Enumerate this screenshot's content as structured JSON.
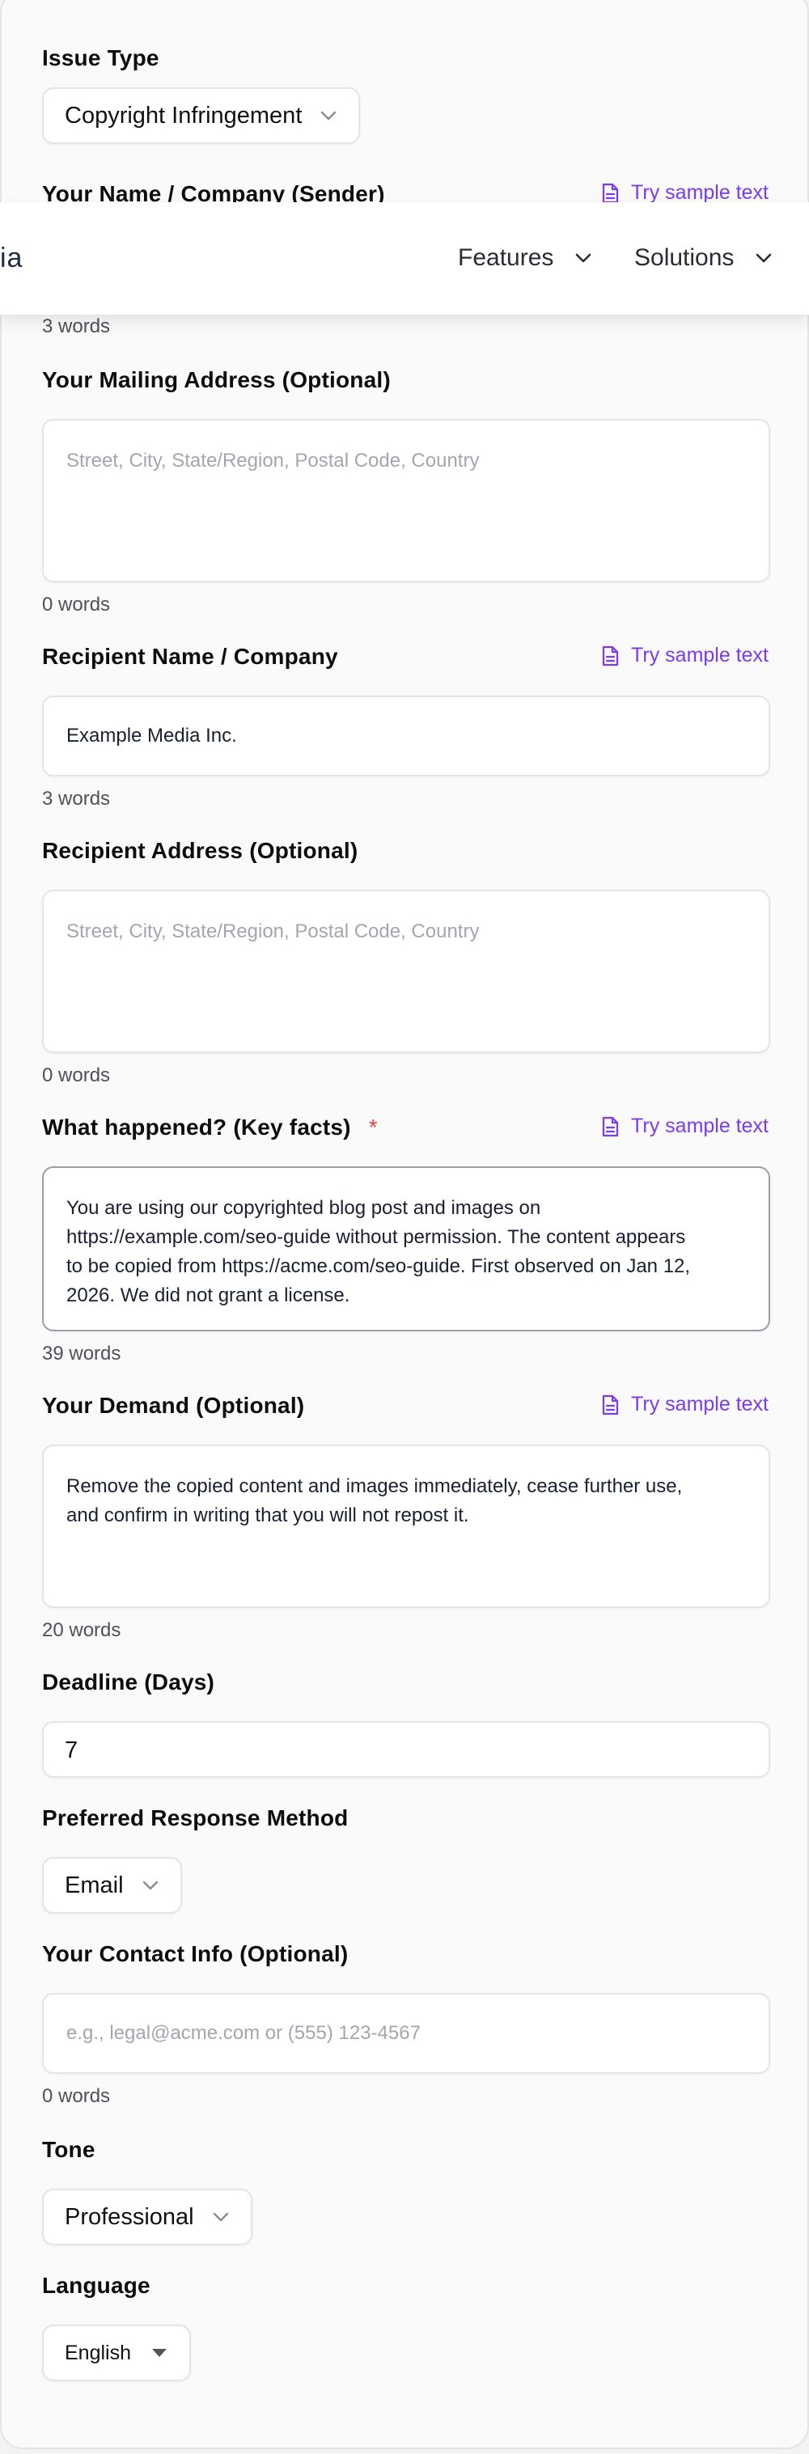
{
  "header": {
    "logo_fragment": "ia",
    "nav": [
      {
        "label": "Features"
      },
      {
        "label": "Solutions"
      }
    ]
  },
  "sample_text_label": "Try sample text",
  "form": {
    "issue_type": {
      "label": "Issue Type",
      "value": "Copyright Infringement"
    },
    "sender": {
      "label": "Your Name / Company (Sender)",
      "count": "3 words"
    },
    "mailing_address": {
      "label": "Your Mailing Address (Optional)",
      "placeholder": "Street, City, State/Region, Postal Code, Country",
      "count": "0 words"
    },
    "recipient_name": {
      "label": "Recipient Name / Company",
      "value": "Example Media Inc.",
      "count": "3 words"
    },
    "recipient_address": {
      "label": "Recipient Address (Optional)",
      "placeholder": "Street, City, State/Region, Postal Code, Country",
      "count": "0 words"
    },
    "key_facts": {
      "label": "What happened? (Key facts)",
      "required_mark": "*",
      "lines": [
        "You are using our copyrighted blog post and images on",
        "https://example.com/seo-guide without permission. The content appears",
        "to be copied from https://acme.com/seo-guide. First observed on Jan 12,",
        "2026. We did not grant a license."
      ],
      "count": "39 words"
    },
    "demand": {
      "label": "Your Demand (Optional)",
      "lines": [
        "Remove the copied content and images immediately, cease further use,",
        "and confirm in writing that you will not repost it."
      ],
      "count": "20 words"
    },
    "deadline": {
      "label": "Deadline (Days)",
      "value": "7"
    },
    "response_method": {
      "label": "Preferred Response Method",
      "value": "Email"
    },
    "contact_info": {
      "label": "Your Contact Info (Optional)",
      "placeholder": "e.g., legal@acme.com or (555) 123-4567",
      "count": "0 words"
    },
    "tone": {
      "label": "Tone",
      "value": "Professional"
    },
    "language": {
      "label": "Language",
      "value": "English"
    }
  },
  "colors": {
    "accent": "#7c3aed",
    "required": "#ef4444",
    "text": "#111111",
    "muted": "#505058",
    "placeholder": "#a3a6ae",
    "border": "#e5e5e8"
  }
}
